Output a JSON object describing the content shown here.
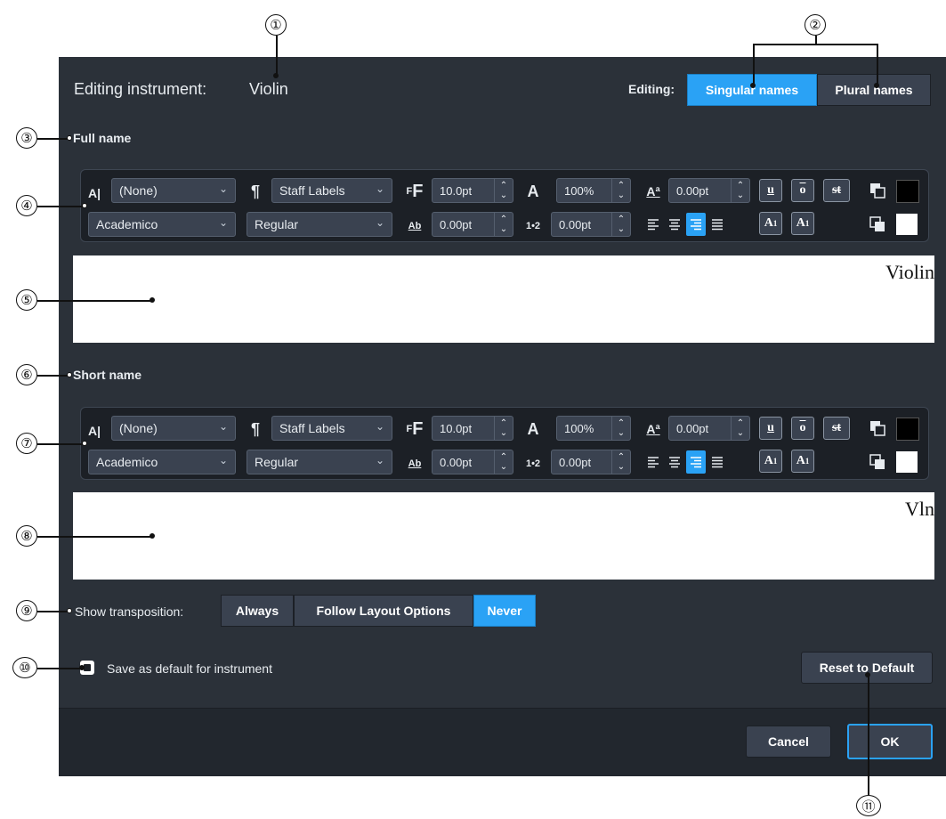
{
  "dialog": {
    "editing_label": "Editing instrument:",
    "instrument": "Violin",
    "editing_mode_label": "Editing:",
    "mode_options": [
      "Singular names",
      "Plural names"
    ],
    "mode_selected": "Singular names"
  },
  "full_name": {
    "heading": "Full name",
    "preview_text": "Violin"
  },
  "short_name": {
    "heading": "Short name",
    "preview_text": "Vln"
  },
  "toolbar": {
    "char_style": "(None)",
    "para_style": "Staff Labels",
    "font_size": "10.0pt",
    "scale": "100%",
    "baseline": "0.00pt",
    "font": "Academico",
    "font_style": "Regular",
    "char_spacing": "0.00pt",
    "word_spacing": "0.00pt",
    "underline": "u",
    "overline": "o",
    "strikethrough": "st",
    "superscript": "A",
    "superscript_num": "1",
    "subscript": "A",
    "subscript_num": "1",
    "alignment_selected": "right",
    "text_color": "#000000",
    "background_color": "#ffffff"
  },
  "transposition": {
    "label": "Show transposition:",
    "options": [
      "Always",
      "Follow Layout Options",
      "Never"
    ],
    "selected": "Never"
  },
  "save_default": {
    "label": "Save as default for instrument",
    "checked": true
  },
  "buttons": {
    "reset": "Reset to Default",
    "cancel": "Cancel",
    "ok": "OK"
  },
  "callouts": [
    "①",
    "②",
    "③",
    "④",
    "⑤",
    "⑥",
    "⑦",
    "⑧",
    "⑨",
    "⑩",
    "⑪"
  ],
  "colors": {
    "dialog_bg": "#2b3139",
    "accent": "#2aa2f5",
    "button": "#3a4250"
  }
}
